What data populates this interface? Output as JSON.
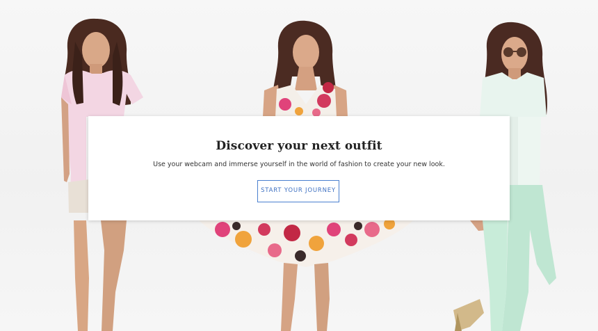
{
  "hero": {
    "images": [
      "model-left",
      "model-center",
      "model-right"
    ]
  },
  "card": {
    "title": "Discover your next outfit",
    "subtitle": "Use your webcam and immerse yourself in the world of fashion to create your new look.",
    "button_label": "START YOUR JOURNEY",
    "accent_color": "#4a7fcf"
  }
}
